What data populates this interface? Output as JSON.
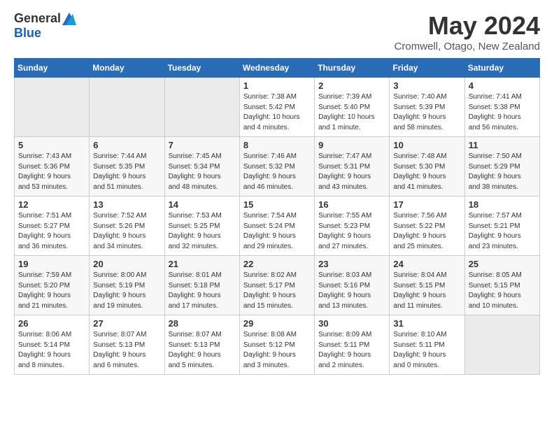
{
  "logo": {
    "general": "General",
    "blue": "Blue"
  },
  "title": "May 2024",
  "location": "Cromwell, Otago, New Zealand",
  "days_header": [
    "Sunday",
    "Monday",
    "Tuesday",
    "Wednesday",
    "Thursday",
    "Friday",
    "Saturday"
  ],
  "weeks": [
    [
      {
        "num": "",
        "text": "",
        "empty": true
      },
      {
        "num": "",
        "text": "",
        "empty": true
      },
      {
        "num": "",
        "text": "",
        "empty": true
      },
      {
        "num": "1",
        "text": "Sunrise: 7:38 AM\nSunset: 5:42 PM\nDaylight: 10 hours\nand 4 minutes.",
        "empty": false
      },
      {
        "num": "2",
        "text": "Sunrise: 7:39 AM\nSunset: 5:40 PM\nDaylight: 10 hours\nand 1 minute.",
        "empty": false
      },
      {
        "num": "3",
        "text": "Sunrise: 7:40 AM\nSunset: 5:39 PM\nDaylight: 9 hours\nand 58 minutes.",
        "empty": false
      },
      {
        "num": "4",
        "text": "Sunrise: 7:41 AM\nSunset: 5:38 PM\nDaylight: 9 hours\nand 56 minutes.",
        "empty": false
      }
    ],
    [
      {
        "num": "5",
        "text": "Sunrise: 7:43 AM\nSunset: 5:36 PM\nDaylight: 9 hours\nand 53 minutes.",
        "empty": false
      },
      {
        "num": "6",
        "text": "Sunrise: 7:44 AM\nSunset: 5:35 PM\nDaylight: 9 hours\nand 51 minutes.",
        "empty": false
      },
      {
        "num": "7",
        "text": "Sunrise: 7:45 AM\nSunset: 5:34 PM\nDaylight: 9 hours\nand 48 minutes.",
        "empty": false
      },
      {
        "num": "8",
        "text": "Sunrise: 7:46 AM\nSunset: 5:32 PM\nDaylight: 9 hours\nand 46 minutes.",
        "empty": false
      },
      {
        "num": "9",
        "text": "Sunrise: 7:47 AM\nSunset: 5:31 PM\nDaylight: 9 hours\nand 43 minutes.",
        "empty": false
      },
      {
        "num": "10",
        "text": "Sunrise: 7:48 AM\nSunset: 5:30 PM\nDaylight: 9 hours\nand 41 minutes.",
        "empty": false
      },
      {
        "num": "11",
        "text": "Sunrise: 7:50 AM\nSunset: 5:29 PM\nDaylight: 9 hours\nand 38 minutes.",
        "empty": false
      }
    ],
    [
      {
        "num": "12",
        "text": "Sunrise: 7:51 AM\nSunset: 5:27 PM\nDaylight: 9 hours\nand 36 minutes.",
        "empty": false
      },
      {
        "num": "13",
        "text": "Sunrise: 7:52 AM\nSunset: 5:26 PM\nDaylight: 9 hours\nand 34 minutes.",
        "empty": false
      },
      {
        "num": "14",
        "text": "Sunrise: 7:53 AM\nSunset: 5:25 PM\nDaylight: 9 hours\nand 32 minutes.",
        "empty": false
      },
      {
        "num": "15",
        "text": "Sunrise: 7:54 AM\nSunset: 5:24 PM\nDaylight: 9 hours\nand 29 minutes.",
        "empty": false
      },
      {
        "num": "16",
        "text": "Sunrise: 7:55 AM\nSunset: 5:23 PM\nDaylight: 9 hours\nand 27 minutes.",
        "empty": false
      },
      {
        "num": "17",
        "text": "Sunrise: 7:56 AM\nSunset: 5:22 PM\nDaylight: 9 hours\nand 25 minutes.",
        "empty": false
      },
      {
        "num": "18",
        "text": "Sunrise: 7:57 AM\nSunset: 5:21 PM\nDaylight: 9 hours\nand 23 minutes.",
        "empty": false
      }
    ],
    [
      {
        "num": "19",
        "text": "Sunrise: 7:59 AM\nSunset: 5:20 PM\nDaylight: 9 hours\nand 21 minutes.",
        "empty": false
      },
      {
        "num": "20",
        "text": "Sunrise: 8:00 AM\nSunset: 5:19 PM\nDaylight: 9 hours\nand 19 minutes.",
        "empty": false
      },
      {
        "num": "21",
        "text": "Sunrise: 8:01 AM\nSunset: 5:18 PM\nDaylight: 9 hours\nand 17 minutes.",
        "empty": false
      },
      {
        "num": "22",
        "text": "Sunrise: 8:02 AM\nSunset: 5:17 PM\nDaylight: 9 hours\nand 15 minutes.",
        "empty": false
      },
      {
        "num": "23",
        "text": "Sunrise: 8:03 AM\nSunset: 5:16 PM\nDaylight: 9 hours\nand 13 minutes.",
        "empty": false
      },
      {
        "num": "24",
        "text": "Sunrise: 8:04 AM\nSunset: 5:15 PM\nDaylight: 9 hours\nand 11 minutes.",
        "empty": false
      },
      {
        "num": "25",
        "text": "Sunrise: 8:05 AM\nSunset: 5:15 PM\nDaylight: 9 hours\nand 10 minutes.",
        "empty": false
      }
    ],
    [
      {
        "num": "26",
        "text": "Sunrise: 8:06 AM\nSunset: 5:14 PM\nDaylight: 9 hours\nand 8 minutes.",
        "empty": false
      },
      {
        "num": "27",
        "text": "Sunrise: 8:07 AM\nSunset: 5:13 PM\nDaylight: 9 hours\nand 6 minutes.",
        "empty": false
      },
      {
        "num": "28",
        "text": "Sunrise: 8:07 AM\nSunset: 5:13 PM\nDaylight: 9 hours\nand 5 minutes.",
        "empty": false
      },
      {
        "num": "29",
        "text": "Sunrise: 8:08 AM\nSunset: 5:12 PM\nDaylight: 9 hours\nand 3 minutes.",
        "empty": false
      },
      {
        "num": "30",
        "text": "Sunrise: 8:09 AM\nSunset: 5:11 PM\nDaylight: 9 hours\nand 2 minutes.",
        "empty": false
      },
      {
        "num": "31",
        "text": "Sunrise: 8:10 AM\nSunset: 5:11 PM\nDaylight: 9 hours\nand 0 minutes.",
        "empty": false
      },
      {
        "num": "",
        "text": "",
        "empty": true
      }
    ]
  ]
}
